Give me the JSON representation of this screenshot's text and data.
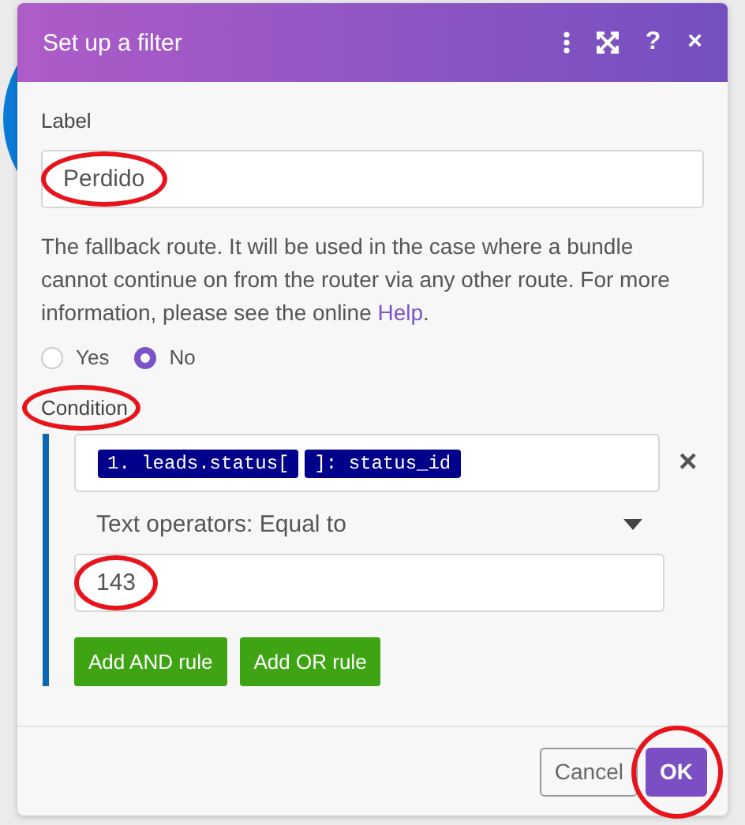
{
  "dialog": {
    "title": "Set up a filter",
    "help_glyph": "?",
    "close_glyph": "×"
  },
  "label_field": {
    "label": "Label",
    "value": "Perdido",
    "circled": true
  },
  "fallback": {
    "description": "The fallback route. It will be used in the case where a bundle cannot continue on from the router via any other route. For more information, please see the online ",
    "link": "Help",
    "after_link": ".",
    "options": [
      {
        "label": "Yes",
        "selected": false
      },
      {
        "label": "No",
        "selected": true
      }
    ]
  },
  "condition": {
    "label": "Condition",
    "circled": true,
    "rules": [
      {
        "tokens": [
          "1. leads.status[",
          "]: status_id"
        ],
        "remove_glyph": "×",
        "operator": "Text operators: Equal to",
        "value": "143",
        "value_circled": true
      }
    ],
    "buttons": [
      "Add AND rule",
      "Add OR rule"
    ]
  },
  "footer": {
    "cancel": "Cancel",
    "ok": "OK",
    "ok_circled": true
  }
}
